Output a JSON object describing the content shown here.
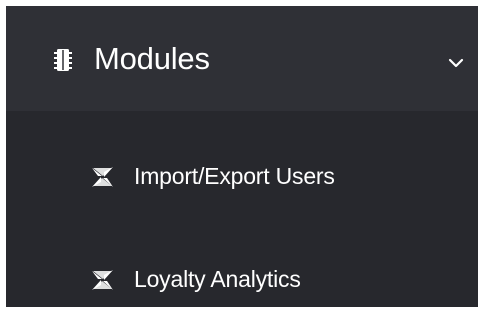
{
  "menu": {
    "label": "Modules",
    "icon": "chip-icon",
    "expand_icon": "chevron-down-icon",
    "expanded": true,
    "items": [
      {
        "label": "Import/Export Users",
        "icon": "module-star-icon"
      },
      {
        "label": "Loyalty Analytics",
        "icon": "module-star-icon"
      }
    ]
  },
  "colors": {
    "header_bg": "#2f3036",
    "submenu_bg": "#27282d",
    "text": "#ffffff",
    "page_bg": "#ffffff"
  }
}
